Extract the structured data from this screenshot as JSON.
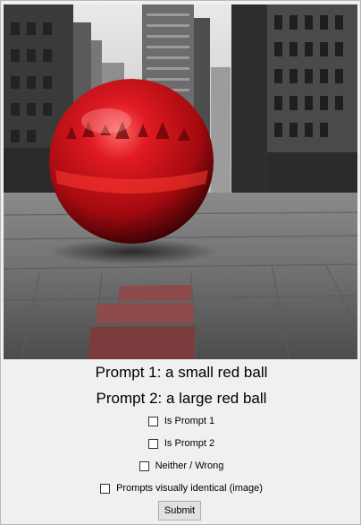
{
  "image": {
    "description_icon": "red-glass-sphere-on-city-street-photo"
  },
  "prompts": {
    "prompt1": "Prompt 1: a small red ball",
    "prompt2": "Prompt 2: a large red ball"
  },
  "options": [
    {
      "label": "Is Prompt 1",
      "checked": false
    },
    {
      "label": "Is Prompt 2",
      "checked": false
    },
    {
      "label": "Neither / Wrong",
      "checked": false
    },
    {
      "label": "Prompts visually identical (image)",
      "checked": false
    }
  ],
  "submit_label": "Submit",
  "colors": {
    "window_bg": "#f0f0f0",
    "button_bg": "#e1e1e1",
    "ball_red": "#c8101a"
  }
}
